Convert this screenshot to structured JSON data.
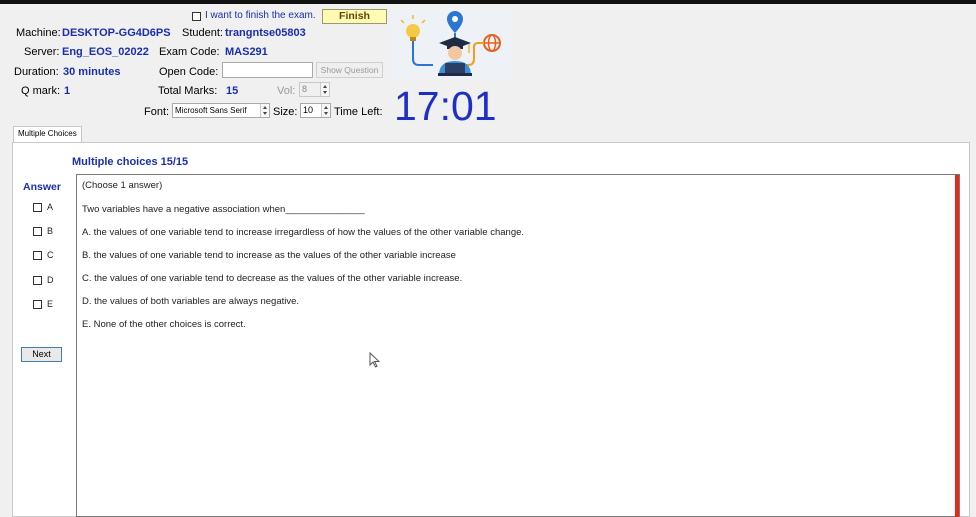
{
  "header": {
    "finish_checkbox_label": "I want to finish the exam.",
    "finish_button": "Finish",
    "machine_label": "Machine:",
    "machine_value": "DESKTOP-GG4D6PS",
    "student_label": "Student:",
    "student_value": "trangntse05803",
    "server_label": "Server:",
    "server_value": "Eng_EOS_02022",
    "exam_code_label": "Exam Code:",
    "exam_code_value": "MAS291",
    "duration_label": "Duration:",
    "duration_value": "30 minutes",
    "open_code_label": "Open Code:",
    "show_question_button": "Show Question",
    "qmark_label": "Q mark:",
    "qmark_value": "1",
    "total_marks_label": "Total Marks:",
    "total_marks_value": "15",
    "vol_label": "Vol:",
    "vol_value": "8",
    "font_label": "Font:",
    "font_value": "Microsoft Sans Serif",
    "size_label": "Size:",
    "size_value": "10",
    "time_left_label": "Time Left:",
    "time_left_value": "17:01"
  },
  "tabs": [
    "Multiple Choices"
  ],
  "question": {
    "heading": "Multiple choices 15/15",
    "answer_label": "Answer",
    "instruction": "(Choose 1 answer)",
    "stem": "Two variables have a negative association when_______________",
    "options": [
      "A.  the values of one variable tend to increase irregardless of how the values of the other variable change.",
      "B.  the values of one variable tend to increase as the values of the other variable increase",
      "C.  the values of one variable tend to decrease as the values of the other variable increase.",
      "D.  the values of both variables are always negative.",
      "E.  None of the other choices is correct."
    ],
    "answer_letters": [
      "A",
      "B",
      "C",
      "D",
      "E"
    ],
    "next_button": "Next"
  },
  "colors": {
    "value_blue": "#1a2fb0",
    "timer_blue": "#1d2fc7",
    "finish_yellow": "#fffbb4",
    "scroll_red": "#e8261a"
  }
}
